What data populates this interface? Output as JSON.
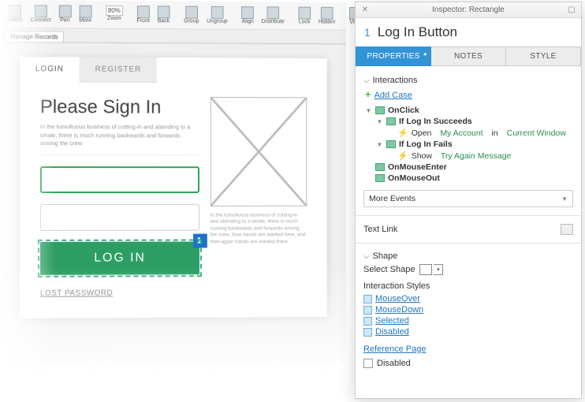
{
  "toolbar": {
    "buttons": [
      "Select",
      "Connect",
      "Pen",
      "More",
      "Zoom",
      "Front",
      "Back",
      "Group",
      "Ungroup",
      "Align",
      "Distribute",
      "Lock",
      "Hidden",
      "View"
    ],
    "zoom": "80%",
    "tab_label": "Manage Records"
  },
  "page": {
    "tabs": {
      "login": "LOGIN",
      "register": "REGISTER"
    },
    "heading": "Please Sign In",
    "description": "In the tumultuous business of cutting-in and attending to a whale, there is much running backwards and forwards among the crew.",
    "login_button": "LOG IN",
    "note_number": "1",
    "lost_password": "LOST PASSWORD",
    "placeholder_text": "In the tumultuous business of cutting-in and attending to a whale, there is much running backwards and forwards among the crew. Now hands are wanted here, and then again hands are wanted there."
  },
  "inspector": {
    "title": "Inspector: Rectangle",
    "note_index": "1",
    "widget_name": "Log In Button",
    "tabs": {
      "properties": "PROPERTIES",
      "notes": "NOTES",
      "style": "STYLE"
    },
    "sections": {
      "interactions": "Interactions",
      "add_case": "Add Case",
      "text_link": "Text Link",
      "shape": "Shape",
      "select_shape": "Select Shape",
      "interaction_styles": "Interaction Styles",
      "reference_page": "Reference Page",
      "disabled": "Disabled"
    },
    "events": {
      "onclick": "OnClick",
      "if_success": "If Log In Succeeds",
      "open_pre": "Open",
      "open_target": "My Account",
      "open_mid": "in",
      "open_window": "Current Window",
      "if_fail": "If Log In Fails",
      "show_pre": "Show",
      "show_target": "Try Again Message",
      "mouseenter": "OnMouseEnter",
      "mouseout": "OnMouseOut",
      "more_events": "More Events"
    },
    "styles": [
      "MouseOver",
      "MouseDown",
      "Selected",
      "Disabled"
    ]
  }
}
